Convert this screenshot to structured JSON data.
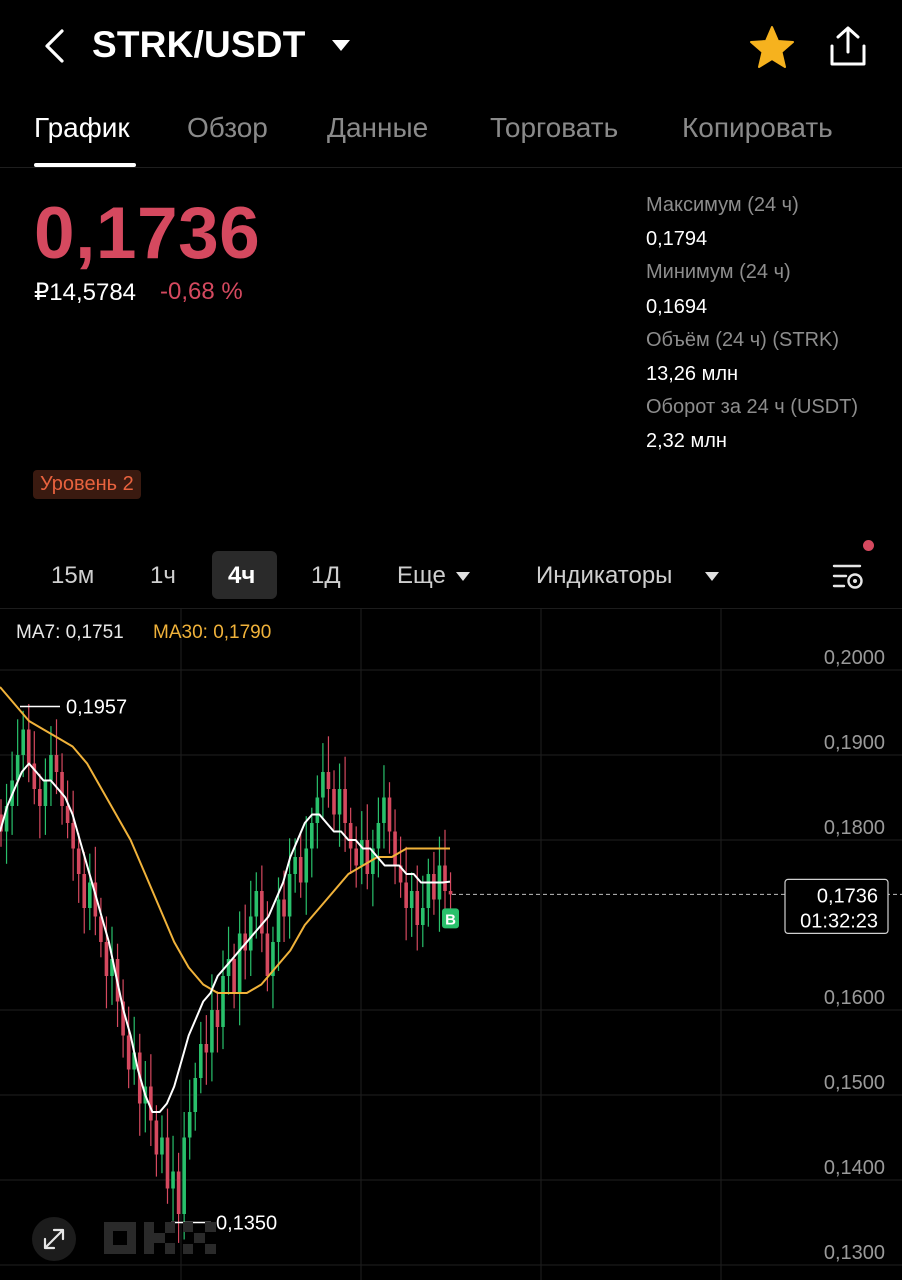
{
  "header": {
    "pair": "STRK/USDT",
    "icons": [
      "back-arrow-icon",
      "caret-down-icon",
      "star-icon",
      "share-icon"
    ],
    "star_color": "#f6b21e"
  },
  "tabs": [
    {
      "label": "График",
      "active": true
    },
    {
      "label": "Обзор",
      "active": false
    },
    {
      "label": "Данные",
      "active": false
    },
    {
      "label": "Торговать",
      "active": false
    },
    {
      "label": "Копировать",
      "active": false
    }
  ],
  "ticker": {
    "price": "0,1736",
    "price_rub": "₽14,5784",
    "change": "-0,68 %",
    "down_color": "#d5495f",
    "up_color": "#29c06b"
  },
  "stats": [
    {
      "label": "Максимум (24 ч)",
      "value": "0,1794"
    },
    {
      "label": "Минимум (24 ч)",
      "value": "0,1694"
    },
    {
      "label": "Объём (24 ч) (STRK)",
      "value": "13,26 млн"
    },
    {
      "label": "Оборот за 24 ч (USDT)",
      "value": "2,32 млн"
    }
  ],
  "level_badge": "Уровень 2",
  "intervals": {
    "items": [
      {
        "label": "15м",
        "active": false
      },
      {
        "label": "1ч",
        "active": false
      },
      {
        "label": "4ч",
        "active": true
      },
      {
        "label": "1Д",
        "active": false
      }
    ],
    "more": "Еще",
    "indicators": "Индикаторы"
  },
  "ma": {
    "ma7": "MA7: 0,1751",
    "ma30": "MA30: 0,1790",
    "ma7_color": "#ffffff",
    "ma30_color": "#f0b23a"
  },
  "chart_data": {
    "type": "candlestick",
    "ylim": [
      0.13,
      0.2
    ],
    "y_ticks": [
      "0,2000",
      "0,1900",
      "0,1800",
      "0,1600",
      "0,1500",
      "0,1400",
      "0,1300"
    ],
    "y_tick_values": [
      0.2,
      0.19,
      0.18,
      0.16,
      0.15,
      0.14,
      0.13
    ],
    "high_marker": {
      "label": "0,1957",
      "value": 0.1957
    },
    "low_marker": {
      "label": "0,1350",
      "value": 0.135
    },
    "current": {
      "label": "0,1736",
      "countdown": "01:32:23",
      "value": 0.1736
    },
    "signal_badge": "B",
    "close": [
      0.181,
      0.184,
      0.187,
      0.19,
      0.193,
      0.189,
      0.186,
      0.184,
      0.187,
      0.19,
      0.188,
      0.184,
      0.182,
      0.179,
      0.176,
      0.172,
      0.175,
      0.171,
      0.168,
      0.164,
      0.166,
      0.161,
      0.157,
      0.153,
      0.155,
      0.149,
      0.151,
      0.147,
      0.143,
      0.145,
      0.139,
      0.141,
      0.136,
      0.145,
      0.148,
      0.152,
      0.156,
      0.155,
      0.16,
      0.158,
      0.164,
      0.166,
      0.162,
      0.169,
      0.167,
      0.171,
      0.174,
      0.169,
      0.164,
      0.168,
      0.173,
      0.171,
      0.176,
      0.178,
      0.175,
      0.179,
      0.182,
      0.185,
      0.188,
      0.186,
      0.183,
      0.186,
      0.182,
      0.179,
      0.177,
      0.18,
      0.176,
      0.179,
      0.182,
      0.185,
      0.181,
      0.177,
      0.175,
      0.172,
      0.174,
      0.17,
      0.172,
      0.176,
      0.173,
      0.177,
      0.174,
      0.1736
    ],
    "ma7": [
      0.181,
      0.184,
      0.186,
      0.188,
      0.189,
      0.188,
      0.187,
      0.187,
      0.186,
      0.185,
      0.183,
      0.18,
      0.177,
      0.174,
      0.171,
      0.168,
      0.164,
      0.16,
      0.157,
      0.153,
      0.15,
      0.148,
      0.148,
      0.149,
      0.151,
      0.154,
      0.157,
      0.159,
      0.161,
      0.162,
      0.164,
      0.165,
      0.166,
      0.167,
      0.168,
      0.169,
      0.17,
      0.171,
      0.173,
      0.175,
      0.178,
      0.18,
      0.182,
      0.183,
      0.183,
      0.182,
      0.181,
      0.181,
      0.18,
      0.18,
      0.179,
      0.179,
      0.178,
      0.177,
      0.177,
      0.177,
      0.176,
      0.176,
      0.175,
      0.175,
      0.175,
      0.175,
      0.1751
    ],
    "ma30": [
      0.198,
      0.196,
      0.194,
      0.193,
      0.192,
      0.191,
      0.189,
      0.186,
      0.183,
      0.18,
      0.176,
      0.172,
      0.168,
      0.165,
      0.163,
      0.162,
      0.162,
      0.162,
      0.163,
      0.165,
      0.167,
      0.17,
      0.172,
      0.174,
      0.176,
      0.177,
      0.178,
      0.178,
      0.179,
      0.179,
      0.179,
      0.179
    ],
    "watermark": "OKX"
  }
}
